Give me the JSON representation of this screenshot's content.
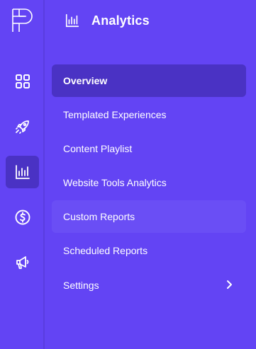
{
  "colors": {
    "background": "#6344f4",
    "active": "#4a32c4",
    "hover": "#6a4ef5",
    "text": "#ffffff"
  },
  "rail": {
    "logo": "brand-logo",
    "items": [
      {
        "icon": "grid-icon",
        "active": false
      },
      {
        "icon": "rocket-icon",
        "active": false
      },
      {
        "icon": "bar-chart-icon",
        "active": true
      },
      {
        "icon": "dollar-icon",
        "active": false
      },
      {
        "icon": "megaphone-icon",
        "active": false
      }
    ]
  },
  "header": {
    "icon": "bar-chart-icon",
    "title": "Analytics"
  },
  "menu": {
    "items": [
      {
        "label": "Overview",
        "state": "active"
      },
      {
        "label": "Templated Experiences",
        "state": "default"
      },
      {
        "label": "Content Playlist",
        "state": "default"
      },
      {
        "label": "Website Tools Analytics",
        "state": "default"
      },
      {
        "label": "Custom Reports",
        "state": "hover"
      },
      {
        "label": "Scheduled Reports",
        "state": "default"
      },
      {
        "label": "Settings",
        "state": "default",
        "icon": "chevron-right-icon"
      }
    ]
  }
}
